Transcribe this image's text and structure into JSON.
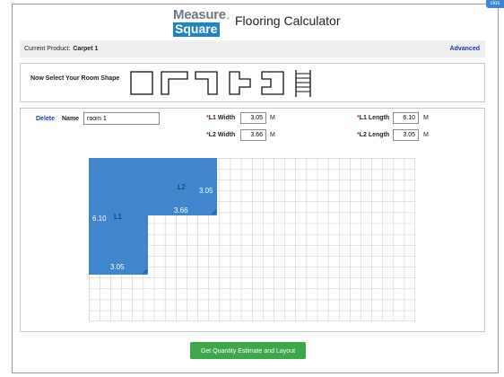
{
  "close_label": "clos",
  "logo": {
    "top": "Measure",
    "bottom": "Square"
  },
  "app_title": "Flooring Calculator",
  "product": {
    "label": "Current Product:",
    "value": "Carpet 1",
    "advanced": "Advanced"
  },
  "shapes": {
    "prompt": "Now Select Your Room Shape",
    "options": [
      "rectangle-shape-icon",
      "l-shape-icon",
      "reverse-l-shape-icon",
      "t-shape-icon",
      "u-shape-icon",
      "stairs-icon"
    ]
  },
  "room": {
    "delete": "Delete",
    "name_label": "Name",
    "name_value": "room 1",
    "l1_width_label": "L1 Width",
    "l1_width": "3.05",
    "l2_width_label": "L2 Width",
    "l2_width": "3.66",
    "l1_length_label": "L1 Length",
    "l1_length": "6.10",
    "l2_length_label": "L2 Length",
    "l2_length": "3.05",
    "required_mark": "*",
    "unit": "M"
  },
  "drawing": {
    "fill_color": "#3f86cc",
    "l1": "L1",
    "l2": "L2",
    "l1_length": "6.10",
    "l1_width": "3.05",
    "l2_length": "3.05",
    "l2_width": "3.66"
  },
  "estimate_button": "Get Quantity Estimate and Layout"
}
